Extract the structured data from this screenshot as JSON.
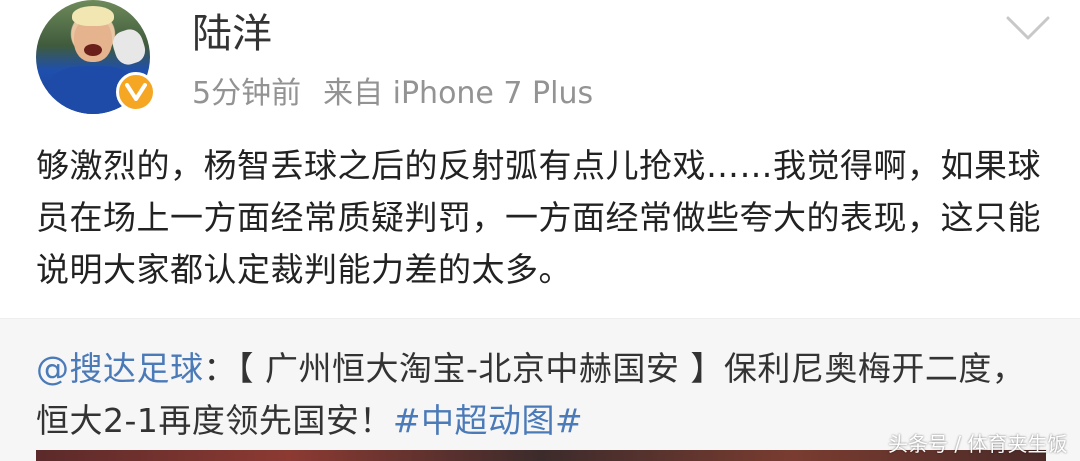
{
  "post": {
    "username": "陆洋",
    "time": "5分钟前",
    "source": "来自 iPhone 7 Plus",
    "content": "够激烈的，杨智丢球之后的反射弧有点儿抢戏……我觉得啊，如果球员在场上一方面经常质疑判罚，一方面经常做些夸大的表现，这只能说明大家都认定裁判能力差的太多。",
    "avatar_icon": "avatar-icon",
    "verified_icon": "verified-badge-icon",
    "menu_icon": "chevron-down-icon"
  },
  "retweet": {
    "mention": "@搜达足球",
    "separator": "：",
    "body": "【 广州恒大淘宝-北京中赫国安 】保利尼奥梅开二度，恒大2-1再度领先国安！",
    "hashtag": "#中超动图#"
  },
  "watermark": "头条号 / 体育夹生饭",
  "colors": {
    "link": "#4b7ab8",
    "badge": "#f5a623",
    "meta": "#939393",
    "retweet_bg": "#f6f6f6"
  }
}
